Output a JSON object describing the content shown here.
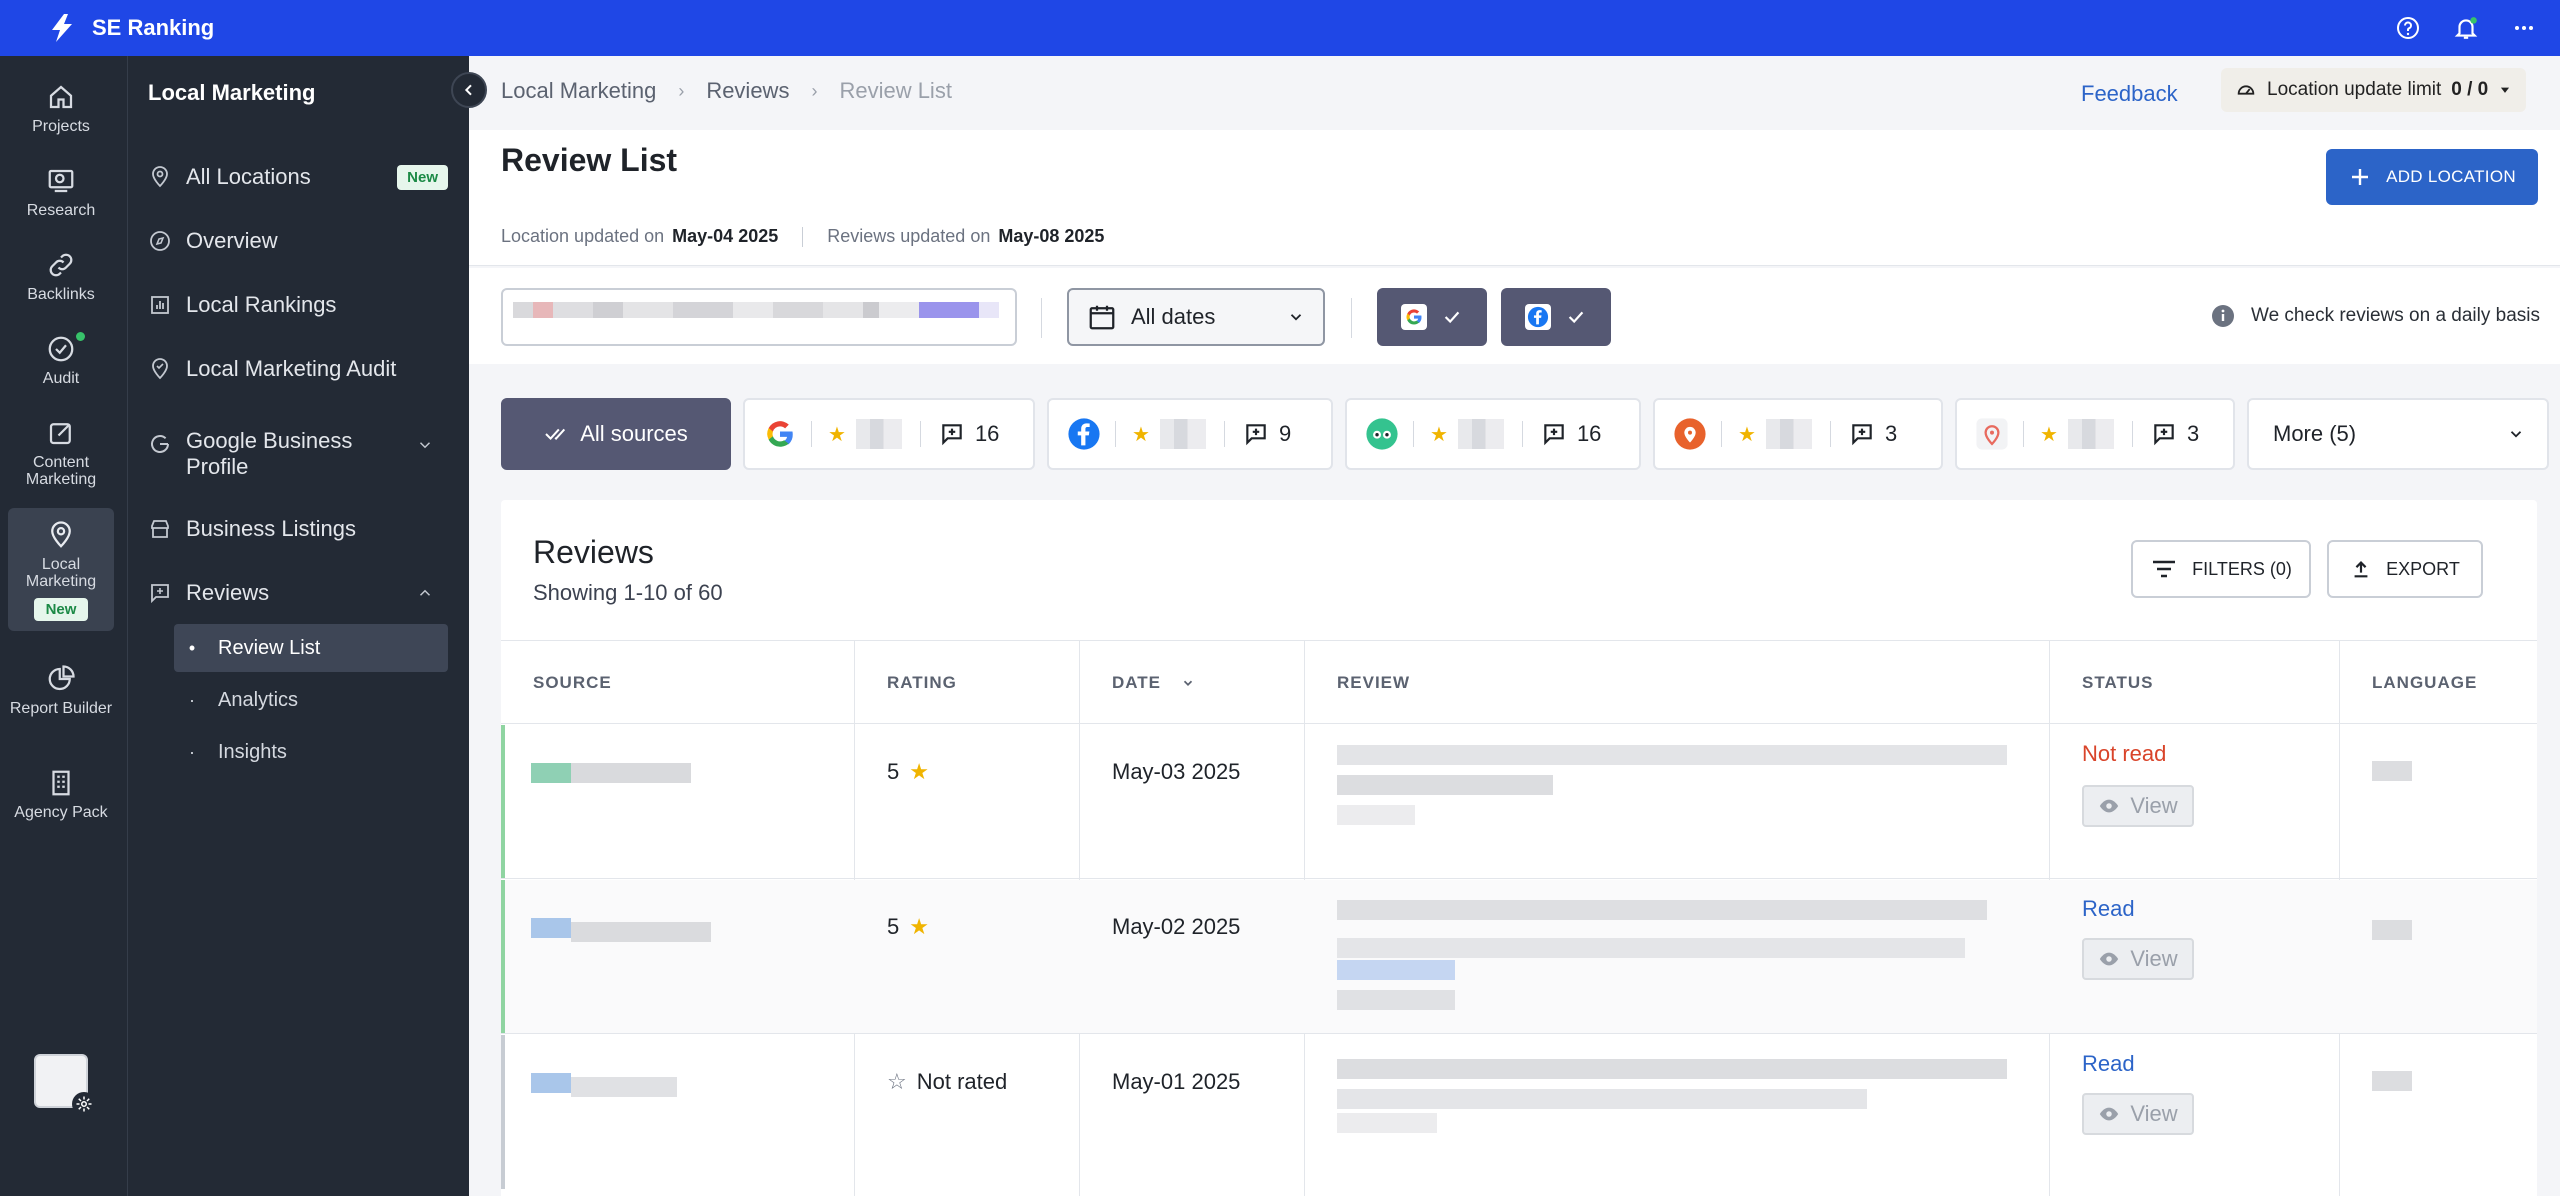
{
  "topbar": {
    "brand": "SE Ranking"
  },
  "rail": {
    "items": [
      {
        "label": "Projects"
      },
      {
        "label": "Research"
      },
      {
        "label": "Backlinks"
      },
      {
        "label": "Audit"
      },
      {
        "label": "Content Marketing"
      },
      {
        "label": "Local Marketing",
        "badge": "New"
      },
      {
        "label": "Report Builder"
      },
      {
        "label": "Agency Pack"
      }
    ]
  },
  "sidebar": {
    "title": "Local Marketing",
    "items": [
      {
        "label": "All Locations",
        "badge": "New"
      },
      {
        "label": "Overview"
      },
      {
        "label": "Local Rankings"
      },
      {
        "label": "Local Marketing Audit"
      },
      {
        "label": "Google Business Profile"
      },
      {
        "label": "Business Listings"
      },
      {
        "label": "Reviews"
      }
    ],
    "reviews_sub": [
      {
        "label": "Review List"
      },
      {
        "label": "Analytics"
      },
      {
        "label": "Insights"
      }
    ]
  },
  "breadcrumb": {
    "items": [
      "Local Marketing",
      "Reviews",
      "Review List"
    ]
  },
  "header": {
    "feedback": "Feedback",
    "limit_label": "Location update limit",
    "limit_value": "0 / 0",
    "title": "Review List",
    "location_updated_label": "Location updated on",
    "location_updated_date": "May-04 2025",
    "reviews_updated_label": "Reviews updated on",
    "reviews_updated_date": "May-08 2025",
    "add_location": "ADD LOCATION"
  },
  "filters": {
    "date": "All dates",
    "daily_note": "We check reviews on a daily basis"
  },
  "sources": {
    "all_label": "All sources",
    "tabs": [
      {
        "icon": "google-icon",
        "count": "16"
      },
      {
        "icon": "facebook-icon",
        "count": "9"
      },
      {
        "icon": "tripadvisor-icon",
        "count": "16"
      },
      {
        "icon": "map-pin-orange-icon",
        "count": "3"
      },
      {
        "icon": "map-pin-outline-icon",
        "count": "3"
      }
    ],
    "more_label": "More (5)"
  },
  "reviews": {
    "title": "Reviews",
    "showing": "Showing 1-10 of 60",
    "filters_btn": "FILTERS (0)",
    "export_btn": "EXPORT",
    "columns": [
      "SOURCE",
      "RATING",
      "DATE",
      "REVIEW",
      "STATUS",
      "LANGUAGE"
    ],
    "view_label": "View",
    "rows": [
      {
        "rating": "5",
        "date": "May-03 2025",
        "status": "Not read"
      },
      {
        "rating": "5",
        "date": "May-02 2025",
        "status": "Read"
      },
      {
        "rating": "Not rated",
        "date": "May-01 2025",
        "status": "Read"
      }
    ]
  },
  "colors": {
    "topbar": "#1f47e6",
    "sidebar": "#232a35",
    "accent": "#2c64c8",
    "chip": "#555873",
    "not_read": "#d9442a",
    "star": "#f0b400"
  }
}
